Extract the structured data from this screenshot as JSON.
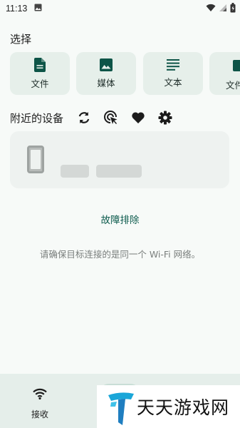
{
  "status_bar": {
    "time": "11:13"
  },
  "pick_section": {
    "title": "选择",
    "items": [
      {
        "label": "文件",
        "icon": "file-icon"
      },
      {
        "label": "媒体",
        "icon": "image-icon"
      },
      {
        "label": "文本",
        "icon": "text-icon"
      },
      {
        "label": "文件",
        "icon": "folder-icon"
      }
    ]
  },
  "nearby": {
    "title": "附近的设备",
    "icons": [
      "refresh-icon",
      "cursor-click-icon",
      "heart-icon",
      "settings-icon"
    ]
  },
  "troubleshoot_label": "故障排除",
  "hint_text": "请确保目标连接的是同一个 Wi-Fi 网络。",
  "bottom_nav": {
    "receive_label": "接收"
  },
  "watermark": {
    "text": "天天游戏网"
  },
  "colors": {
    "accent": "#0d5447",
    "card_bg": "#e6efea",
    "nav_bg": "#e5eeea"
  }
}
